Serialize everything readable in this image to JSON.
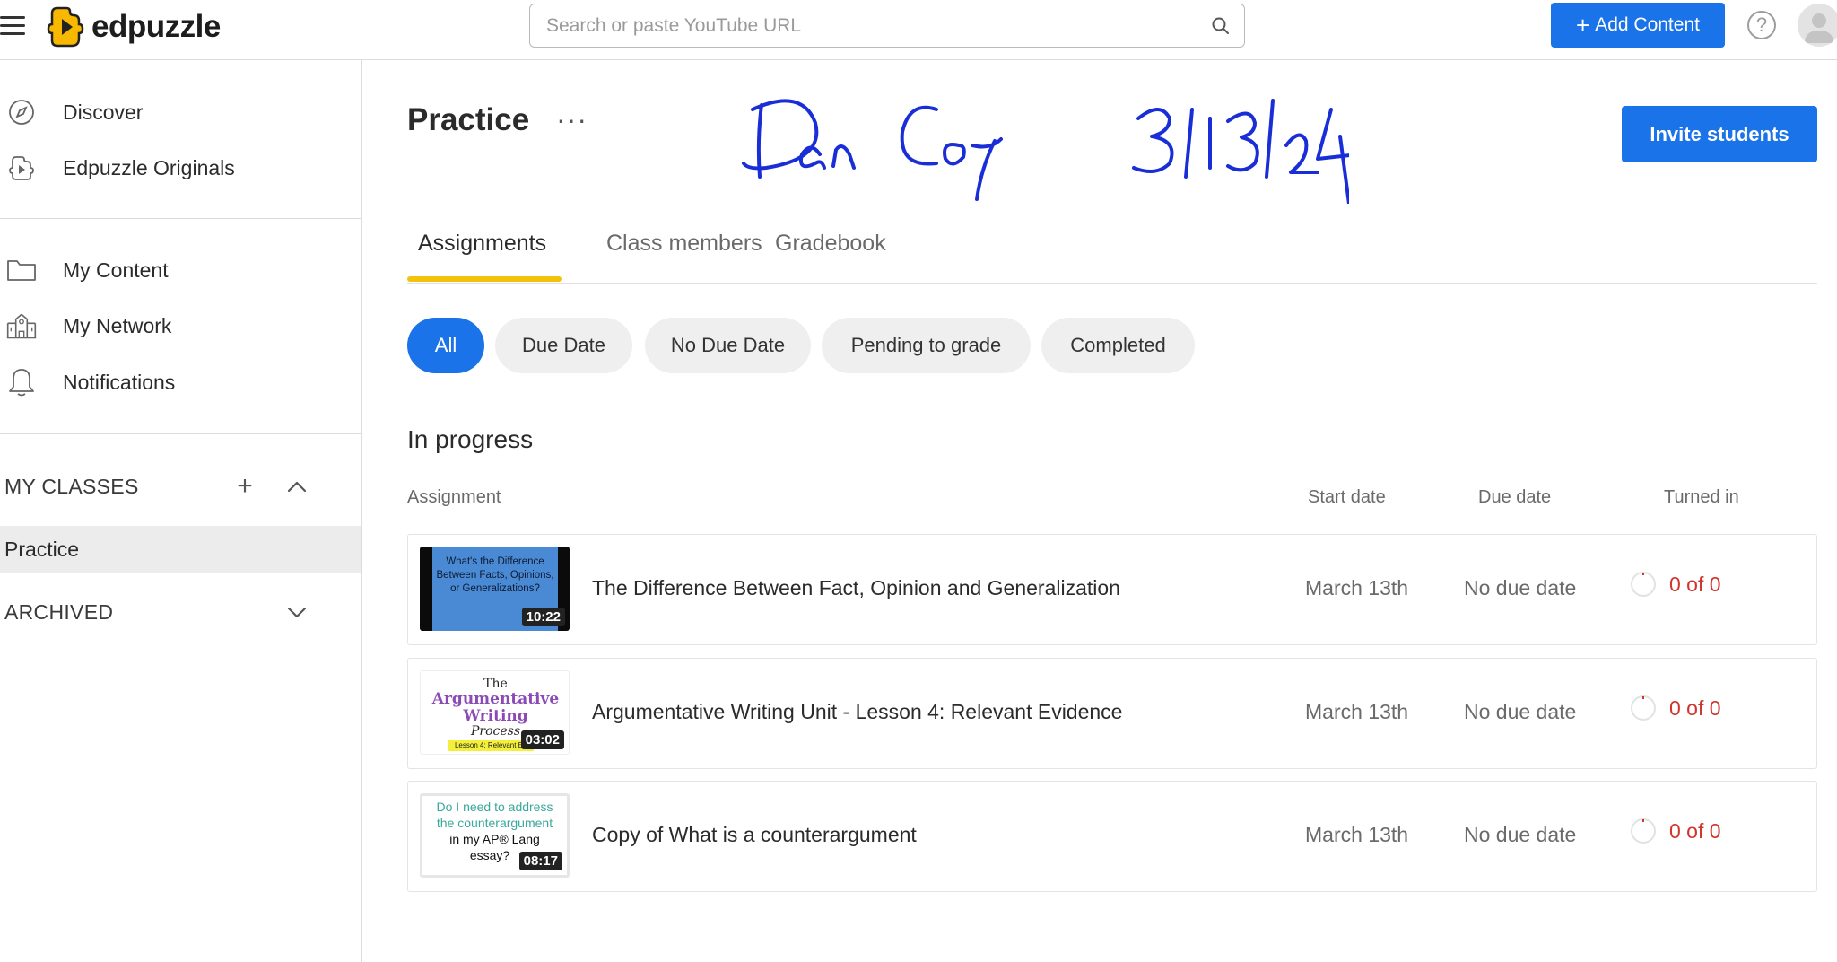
{
  "header": {
    "logo_text": "edpuzzle",
    "search_placeholder": "Search or paste YouTube URL",
    "add_content_label": "Add Content",
    "help_icon": "question-circle-icon",
    "brand_color": "#1a73e8"
  },
  "sidebar": {
    "items": [
      {
        "label": "Discover",
        "icon": "compass-icon"
      },
      {
        "label": "Edpuzzle Originals",
        "icon": "edpuzzle-puzzle-icon"
      },
      {
        "label": "My Content",
        "icon": "folder-icon"
      },
      {
        "label": "My Network",
        "icon": "school-building-icon"
      },
      {
        "label": "Notifications",
        "icon": "bell-icon"
      }
    ],
    "my_classes_label": "MY CLASSES",
    "classes": [
      {
        "label": "Practice"
      }
    ],
    "archived_label": "ARCHIVED"
  },
  "main": {
    "class_title": "Practice",
    "more_label": "···",
    "handwritten_note": "Dan Cox 3/13/24",
    "invite_label": "Invite students",
    "tabs": [
      {
        "label": "Assignments",
        "active": true
      },
      {
        "label": "Class members",
        "active": false
      },
      {
        "label": "Gradebook",
        "active": false
      }
    ],
    "filters": [
      {
        "label": "All",
        "active": true
      },
      {
        "label": "Due Date",
        "active": false
      },
      {
        "label": "No Due Date",
        "active": false
      },
      {
        "label": "Pending to grade",
        "active": false
      },
      {
        "label": "Completed",
        "active": false
      }
    ],
    "section_title": "In progress",
    "columns": {
      "assignment": "Assignment",
      "start": "Start date",
      "due": "Due date",
      "turned_in": "Turned in"
    },
    "assignments": [
      {
        "title": "The Difference Between Fact, Opinion and Generalization",
        "start": "March 13th",
        "due": "No due date",
        "turned_in": "0 of 0",
        "duration": "10:22",
        "thumb_text": "What's the Difference Between Facts, Opinions, or Generalizations?"
      },
      {
        "title": "Argumentative Writing Unit - Lesson 4: Relevant Evidence",
        "start": "March 13th",
        "due": "No due date",
        "turned_in": "0 of 0",
        "duration": "03:02",
        "thumb_text_1": "The",
        "thumb_text_2": "Argumentative",
        "thumb_text_3": "Writing",
        "thumb_text_4": "Process",
        "thumb_text_5": "Lesson 4: Relevant Ev"
      },
      {
        "title": "Copy of What is a counterargument",
        "start": "March 13th",
        "due": "No due date",
        "turned_in": "0 of 0",
        "duration": "08:17",
        "thumb_text_1": "Do I need to address",
        "thumb_text_2": "the counterargument",
        "thumb_text_3": "in my AP® Lang",
        "thumb_text_4": "essay?"
      }
    ]
  }
}
